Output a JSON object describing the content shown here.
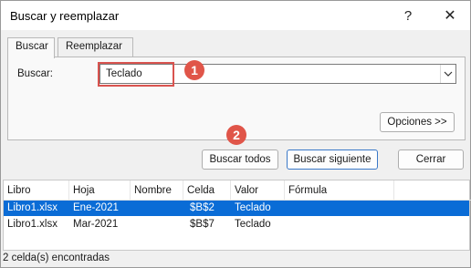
{
  "window": {
    "title": "Buscar y reemplazar",
    "help_icon": "?",
    "close_icon": "✕"
  },
  "tabs": [
    {
      "label": "Buscar",
      "active": true
    },
    {
      "label": "Reemplazar",
      "active": false
    }
  ],
  "find": {
    "label": "Buscar:",
    "value": "Teclado"
  },
  "markers": [
    "1",
    "2"
  ],
  "buttons": {
    "options": "Opciones >>",
    "find_all": "Buscar todos",
    "find_next": "Buscar siguiente",
    "close": "Cerrar"
  },
  "results": {
    "columns": [
      "Libro",
      "Hoja",
      "Nombre",
      "Celda",
      "Valor",
      "Fórmula"
    ],
    "rows": [
      {
        "libro": "Libro1.xlsx",
        "hoja": "Ene-2021",
        "nombre": "",
        "celda": "$B$2",
        "valor": "Teclado",
        "formula": "",
        "selected": true
      },
      {
        "libro": "Libro1.xlsx",
        "hoja": "Mar-2021",
        "nombre": "",
        "celda": "$B$7",
        "valor": "Teclado",
        "formula": "",
        "selected": false
      }
    ]
  },
  "status": "2 celda(s) encontradas",
  "colors": {
    "accent": "#0a6cd6",
    "marker": "#e05549",
    "highlight": "#d9534f"
  }
}
